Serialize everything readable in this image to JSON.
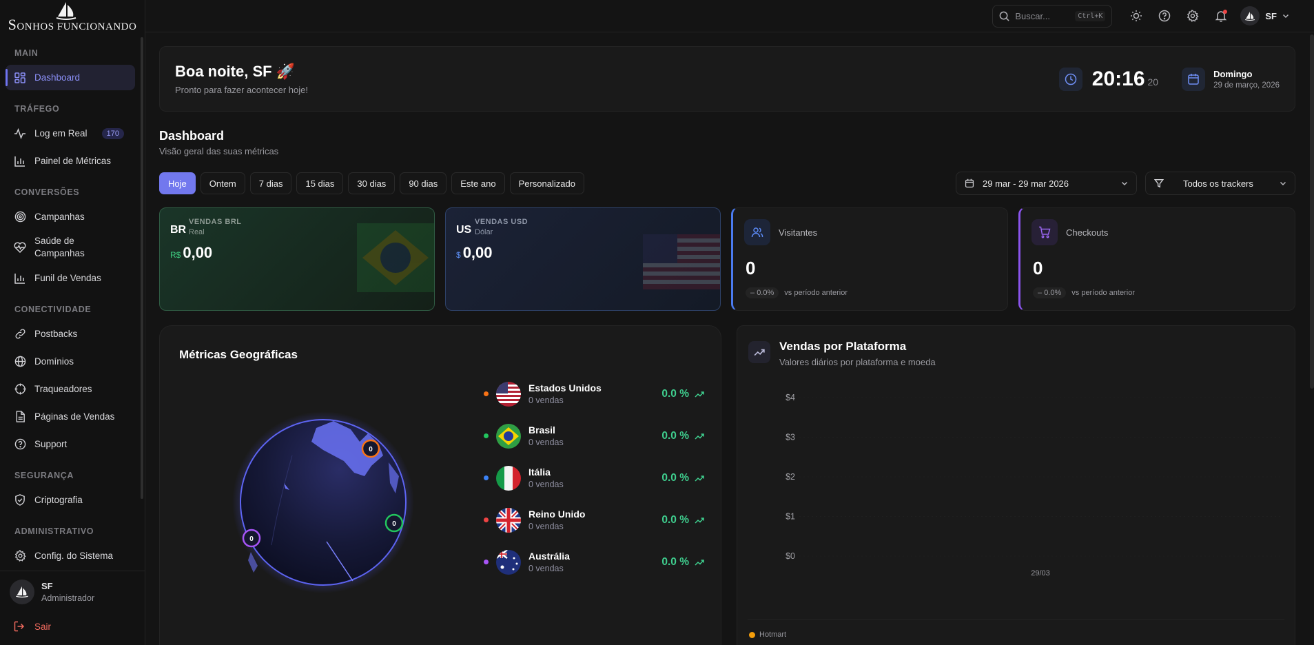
{
  "brand": {
    "name_first": "S",
    "name_rest": "ONHOS FUNCIONANDO"
  },
  "sidebar": {
    "sections": [
      {
        "title": "MAIN"
      },
      {
        "title": "TRÁFEGO"
      },
      {
        "title": "CONVERSÕES"
      },
      {
        "title": "CONECTIVIDADE"
      },
      {
        "title": "SEGURANÇA"
      },
      {
        "title": "ADMINISTRATIVO"
      }
    ],
    "items": [
      {
        "label": "Dashboard",
        "icon": "grid-icon",
        "active": true
      },
      {
        "label": "Log em Real",
        "icon": "activity-icon",
        "badge": "170"
      },
      {
        "label": "Painel de Métricas",
        "icon": "bar-chart-icon"
      },
      {
        "label": "Campanhas",
        "icon": "target-icon"
      },
      {
        "label": "Saúde de Campanhas",
        "icon": "heart-pulse-icon"
      },
      {
        "label": "Funil de Vendas",
        "icon": "bar-chart-icon"
      },
      {
        "label": "Postbacks",
        "icon": "link-icon"
      },
      {
        "label": "Domínios",
        "icon": "globe-icon"
      },
      {
        "label": "Traqueadores",
        "icon": "crosshair-icon"
      },
      {
        "label": "Páginas de Vendas",
        "icon": "file-icon"
      },
      {
        "label": "Support",
        "icon": "help-circle-icon"
      },
      {
        "label": "Criptografia",
        "icon": "shield-icon"
      },
      {
        "label": "Config. do Sistema",
        "icon": "gear-icon"
      }
    ],
    "user": {
      "name": "SF",
      "role": "Administrador"
    },
    "logout": "Sair"
  },
  "topbar": {
    "search_placeholder": "Buscar...",
    "shortcut": "Ctrl+K",
    "user_initials": "SF"
  },
  "greeting": {
    "title": "Boa noite, SF 🚀",
    "subtitle": "Pronto para fazer acontecer hoje!",
    "time": "20:16",
    "seconds": "20",
    "weekday": "Domingo",
    "date": "29 de março, 2026"
  },
  "dashboard": {
    "title": "Dashboard",
    "subtitle": "Visão geral das suas métricas"
  },
  "filters": {
    "periods": [
      "Hoje",
      "Ontem",
      "7 dias",
      "15 dias",
      "30 dias",
      "90 dias",
      "Este ano",
      "Personalizado"
    ],
    "active": "Hoje",
    "date_range": "29 mar - 29 mar 2026",
    "tracker": "Todos os trackers"
  },
  "cards": {
    "brl": {
      "code": "BR",
      "label": "VENDAS BRL",
      "sub": "Real",
      "symbol": "R$",
      "value": "0,00"
    },
    "usd": {
      "code": "US",
      "label": "VENDAS USD",
      "sub": "Dólar",
      "symbol": "$",
      "value": "0,00"
    },
    "visitors": {
      "title": "Visitantes",
      "value": "0",
      "delta": "0.0%",
      "compare": "vs período anterior"
    },
    "checkouts": {
      "title": "Checkouts",
      "value": "0",
      "delta": "0.0%",
      "compare": "vs período anterior"
    }
  },
  "geo": {
    "title": "Métricas Geográficas",
    "markers": [
      "0",
      "0",
      "0"
    ],
    "countries": [
      {
        "name": "Estados Unidos",
        "sales": "0 vendas",
        "pct": "0.0 %",
        "color": "#f97316"
      },
      {
        "name": "Brasil",
        "sales": "0 vendas",
        "pct": "0.0 %",
        "color": "#22c55e"
      },
      {
        "name": "Itália",
        "sales": "0 vendas",
        "pct": "0.0 %",
        "color": "#3b82f6"
      },
      {
        "name": "Reino Unido",
        "sales": "0 vendas",
        "pct": "0.0 %",
        "color": "#ef4444"
      },
      {
        "name": "Austrália",
        "sales": "0 vendas",
        "pct": "0.0 %",
        "color": "#a855f7"
      }
    ]
  },
  "sales_platform": {
    "title": "Vendas por Plataforma",
    "subtitle": "Valores diários por plataforma e moeda"
  },
  "chart_data": {
    "type": "line",
    "title": "Vendas por Plataforma",
    "categories": [
      "29/03"
    ],
    "y_ticks": [
      "$4",
      "$3",
      "$2",
      "$1",
      "$0"
    ],
    "ylim": [
      0,
      4
    ],
    "series": [
      {
        "name": "Hotmart",
        "values": [
          0
        ],
        "color": "#f59e0b"
      }
    ]
  }
}
